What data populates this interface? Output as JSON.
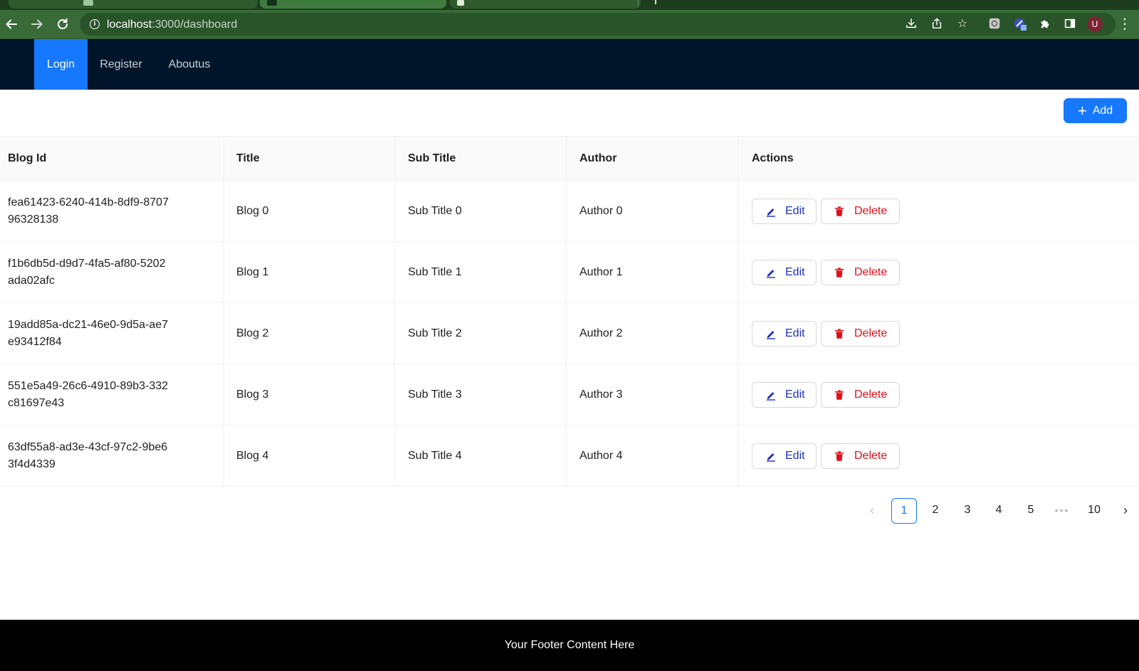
{
  "browser": {
    "url_host": "localhost",
    "url_path": ":3000/dashboard",
    "avatar_initial": "U"
  },
  "nav": {
    "items": [
      {
        "label": "Login",
        "active": true
      },
      {
        "label": "Register",
        "active": false
      },
      {
        "label": "Aboutus",
        "active": false
      }
    ]
  },
  "toolbar": {
    "add_label": "Add"
  },
  "table": {
    "columns": [
      "Blog Id",
      "Title",
      "Sub Title",
      "Author",
      "Actions"
    ],
    "rows": [
      {
        "id": "fea61423-6240-414b-8df9-870796328138",
        "title": "Blog 0",
        "subtitle": "Sub Title 0",
        "author": "Author 0"
      },
      {
        "id": "f1b6db5d-d9d7-4fa5-af80-5202ada02afc",
        "title": "Blog 1",
        "subtitle": "Sub Title 1",
        "author": "Author 1"
      },
      {
        "id": "19add85a-dc21-46e0-9d5a-ae7e93412f84",
        "title": "Blog 2",
        "subtitle": "Sub Title 2",
        "author": "Author 2"
      },
      {
        "id": "551e5a49-26c6-4910-89b3-332c81697e43",
        "title": "Blog 3",
        "subtitle": "Sub Title 3",
        "author": "Author 3"
      },
      {
        "id": "63df55a8-ad3e-43cf-97c2-9be63f4d4339",
        "title": "Blog 4",
        "subtitle": "Sub Title 4",
        "author": "Author 4"
      }
    ],
    "edit_label": "Edit",
    "delete_label": "Delete"
  },
  "pagination": {
    "current": "1",
    "pages": [
      "1",
      "2",
      "3",
      "4",
      "5"
    ],
    "ellipsis": "•••",
    "last": "10"
  },
  "footer": {
    "text": "Your Footer Content Here"
  },
  "colors": {
    "primary": "#1677ff",
    "header_bg": "#001529",
    "danger": "#e0101a",
    "footer_bg": "#000000",
    "browser_chrome": "#386b38"
  },
  "icons": [
    "back-arrow-icon",
    "forward-arrow-icon",
    "reload-icon",
    "info-icon",
    "download-icon",
    "share-icon",
    "bookmark-star-icon",
    "extension-icon",
    "puzzle-icon",
    "sidebar-icon",
    "kebab-menu-icon",
    "plus-icon",
    "edit-pencil-icon",
    "trash-icon",
    "chevron-left-icon",
    "chevron-right-icon"
  ]
}
